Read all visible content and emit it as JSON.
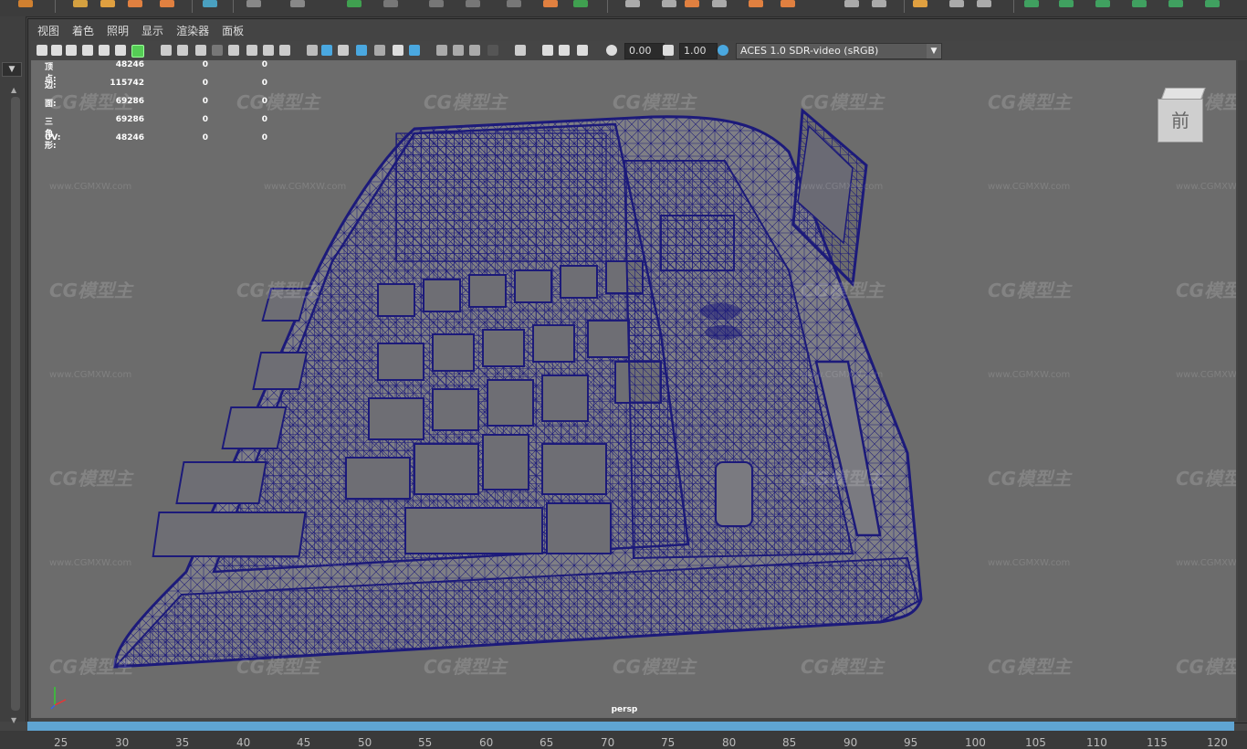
{
  "menu": [
    "视图",
    "着色",
    "照明",
    "显示",
    "渲染器",
    "面板"
  ],
  "toolbar": {
    "exposure_value": "0.00",
    "gamma_value": "1.00",
    "color_management": "ACES 1.0 SDR-video (sRGB)"
  },
  "hud": [
    {
      "label": "顶点:",
      "v1": "48246",
      "v2": "0",
      "v3": "0"
    },
    {
      "label": "边:",
      "v1": "115742",
      "v2": "0",
      "v3": "0"
    },
    {
      "label": "面:",
      "v1": "69286",
      "v2": "0",
      "v3": "0"
    },
    {
      "label": "三角形:",
      "v1": "69286",
      "v2": "0",
      "v3": "0"
    },
    {
      "label": "UV:",
      "v1": "48246",
      "v2": "0",
      "v3": "0"
    }
  ],
  "view_cube_label": "前",
  "camera_name": "persp",
  "watermark": {
    "logo": "CG模型主",
    "url": "www.CGMXW.com"
  },
  "timeline_ticks": [
    "25",
    "30",
    "35",
    "40",
    "45",
    "50",
    "55",
    "60",
    "65",
    "70",
    "75",
    "80",
    "85",
    "90",
    "95",
    "100",
    "105",
    "110",
    "115",
    "120"
  ],
  "colors": {
    "wire": "#1c1a7a",
    "viewport_bg": "#6c6c6c",
    "timebar": "#5fa4d2"
  }
}
